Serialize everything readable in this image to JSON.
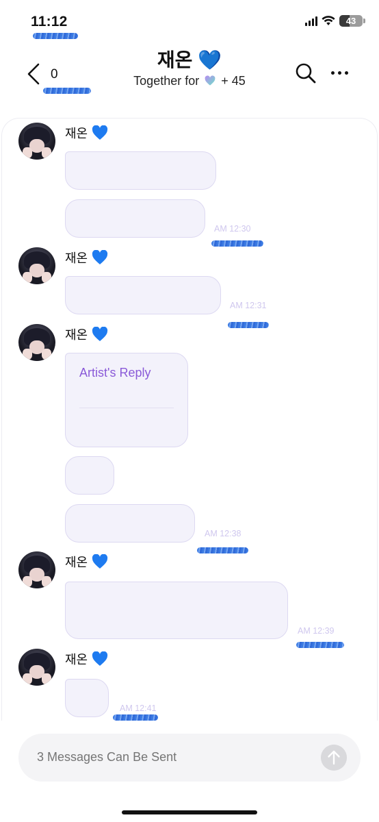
{
  "status_bar": {
    "time": "11:12",
    "battery_level": "43"
  },
  "header": {
    "back_count": "0",
    "title": "재온 💙",
    "subtitle_prefix": "Together for",
    "subtitle_suffix": "+ 45"
  },
  "messages": [
    {
      "sender": "재온",
      "time": "AM 12:30"
    },
    {
      "sender": "재온",
      "time": "AM 12:31"
    },
    {
      "sender": "재온",
      "reply_label": "Artist's Reply",
      "time": "AM 12:38"
    },
    {
      "sender": "재온",
      "time": "AM 12:39"
    },
    {
      "sender": "재온",
      "time": "AM 12:41"
    }
  ],
  "composer": {
    "placeholder": "3 Messages Can Be Sent"
  },
  "colors": {
    "bubble_bg": "#f3f2fb",
    "bubble_border": "#dcd8f1",
    "accent_purple": "#8a5ad8",
    "timestamp": "#cfc7ee",
    "heart_blue": "#1e7bf0"
  }
}
